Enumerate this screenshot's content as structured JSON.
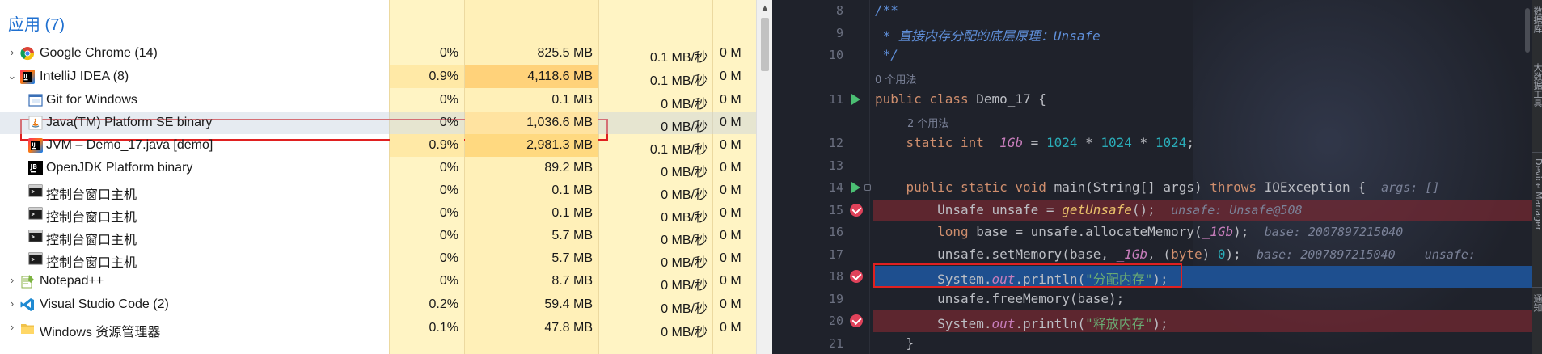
{
  "task_manager": {
    "group_header": "应用 (7)",
    "columns": [],
    "rows": [
      {
        "name": "Google Chrome (14)",
        "icon": "chrome-icon",
        "level": 0,
        "expanded": false,
        "cpu": "0%",
        "memory": "825.5 MB",
        "disk": "0.1 MB/秒",
        "network": "0 M"
      },
      {
        "name": "IntelliJ IDEA (8)",
        "icon": "intellij-icon",
        "level": 0,
        "expanded": true,
        "cpu": "0.9%",
        "memory": "4,118.6 MB",
        "disk": "0.1 MB/秒",
        "network": "0 M"
      },
      {
        "name": "Git for Windows",
        "icon": "git-window-icon",
        "level": 1,
        "cpu": "0%",
        "memory": "0.1 MB",
        "disk": "0 MB/秒",
        "network": "0 M"
      },
      {
        "name": "Java(TM) Platform SE binary",
        "icon": "java-icon",
        "level": 1,
        "selected": true,
        "cpu": "0%",
        "memory": "1,036.6 MB",
        "disk": "0 MB/秒",
        "network": "0 M"
      },
      {
        "name": "JVM – Demo_17.java [demo]",
        "icon": "intellij-icon",
        "level": 1,
        "cpu": "0.9%",
        "memory": "2,981.3 MB",
        "disk": "0.1 MB/秒",
        "network": "0 M"
      },
      {
        "name": "OpenJDK Platform binary",
        "icon": "jb-icon",
        "level": 1,
        "cpu": "0%",
        "memory": "89.2 MB",
        "disk": "0 MB/秒",
        "network": "0 M"
      },
      {
        "name": "控制台窗口主机",
        "icon": "console-icon",
        "level": 1,
        "cpu": "0%",
        "memory": "0.1 MB",
        "disk": "0 MB/秒",
        "network": "0 M"
      },
      {
        "name": "控制台窗口主机",
        "icon": "console-icon",
        "level": 1,
        "cpu": "0%",
        "memory": "0.1 MB",
        "disk": "0 MB/秒",
        "network": "0 M"
      },
      {
        "name": "控制台窗口主机",
        "icon": "console-icon",
        "level": 1,
        "cpu": "0%",
        "memory": "5.7 MB",
        "disk": "0 MB/秒",
        "network": "0 M"
      },
      {
        "name": "控制台窗口主机",
        "icon": "console-icon",
        "level": 1,
        "cpu": "0%",
        "memory": "5.7 MB",
        "disk": "0 MB/秒",
        "network": "0 M"
      },
      {
        "name": "Notepad++",
        "icon": "notepadpp-icon",
        "level": 0,
        "expanded": false,
        "cpu": "0%",
        "memory": "8.7 MB",
        "disk": "0 MB/秒",
        "network": "0 M"
      },
      {
        "name": "Visual Studio Code (2)",
        "icon": "vscode-icon",
        "level": 0,
        "expanded": false,
        "cpu": "0.2%",
        "memory": "59.4 MB",
        "disk": "0 MB/秒",
        "network": "0 M"
      },
      {
        "name": "Windows 资源管理器",
        "icon": "folder-icon",
        "level": 0,
        "expanded": false,
        "cpu": "0.1%",
        "memory": "47.8 MB",
        "disk": "0 MB/秒",
        "network": "0 M"
      }
    ],
    "colors": {
      "header_blue": "#1e6fd0",
      "heat_light": "#fff4c4",
      "heat_mid": "#ffe9a6",
      "heat_strong": "#ffd27a",
      "highlight_box": "#e02020"
    }
  },
  "editor": {
    "lines": [
      {
        "n": "8",
        "tokens": [
          [
            "cmt",
            "/**"
          ]
        ]
      },
      {
        "n": "9",
        "tokens": [
          [
            "cmt",
            " * "
          ],
          [
            "cmtz",
            "直接内存分配的底层原理："
          ],
          [
            "cmt",
            "Unsafe"
          ]
        ]
      },
      {
        "n": "10",
        "tokens": [
          [
            "cmt",
            " */"
          ]
        ]
      },
      {
        "usage": "0 个用法"
      },
      {
        "n": "11",
        "run": true,
        "tokens": [
          [
            "kw",
            "public class "
          ],
          [
            "",
            "Demo_17 {"
          ]
        ]
      },
      {
        "usage": "2 个用法",
        "indent": 1
      },
      {
        "n": "12",
        "tokens": [
          [
            "",
            "    "
          ],
          [
            "kw",
            "static int "
          ],
          [
            "fld",
            "_1Gb"
          ],
          [
            "",
            " = "
          ],
          [
            "num",
            "1024"
          ],
          [
            "",
            " * "
          ],
          [
            "num",
            "1024"
          ],
          [
            "",
            " * "
          ],
          [
            "num",
            "1024"
          ],
          [
            "",
            ";"
          ]
        ]
      },
      {
        "n": "13",
        "tokens": []
      },
      {
        "n": "14",
        "run": true,
        "fold": true,
        "tokens": [
          [
            "",
            "    "
          ],
          [
            "kw",
            "public static void "
          ],
          [
            "",
            "main(String[] args) "
          ],
          [
            "kw",
            "throws "
          ],
          [
            "",
            "IOException {  "
          ],
          [
            "hint",
            "args: []"
          ]
        ]
      },
      {
        "n": "15",
        "bp": true,
        "tokens": [
          [
            "",
            "        Unsafe unsafe = "
          ],
          [
            "mth",
            "getUnsafe"
          ],
          [
            "",
            "();  "
          ],
          [
            "hint",
            "unsafe: Unsafe@508"
          ]
        ]
      },
      {
        "n": "16",
        "tokens": [
          [
            "",
            "        "
          ],
          [
            "kw",
            "long "
          ],
          [
            "",
            "base = unsafe.allocateMemory("
          ],
          [
            "fld",
            "_1Gb"
          ],
          [
            "",
            ");  "
          ],
          [
            "hint",
            "base: 2007897215040"
          ]
        ]
      },
      {
        "n": "17",
        "tokens": [
          [
            "",
            "        unsafe.setMemory(base, "
          ],
          [
            "fld",
            "_1Gb"
          ],
          [
            "",
            ", ("
          ],
          [
            "kw",
            "byte"
          ],
          [
            "",
            ") "
          ],
          [
            "num",
            "0"
          ],
          [
            "",
            ");  "
          ],
          [
            "hint",
            "base: 2007897215040    unsafe: "
          ]
        ]
      },
      {
        "n": "18",
        "bp": true,
        "current": true,
        "tokens": [
          [
            "",
            "        System."
          ],
          [
            "fld",
            "out"
          ],
          [
            "",
            ".println("
          ],
          [
            "str",
            "\"分配内存\""
          ],
          [
            "",
            ");"
          ]
        ]
      },
      {
        "n": "19",
        "tokens": [
          [
            "",
            "        unsafe.freeMemory(base);"
          ]
        ]
      },
      {
        "n": "20",
        "bp": true,
        "tokens": [
          [
            "",
            "        System."
          ],
          [
            "fld",
            "out"
          ],
          [
            "",
            ".println("
          ],
          [
            "str",
            "\"释放内存\""
          ],
          [
            "",
            ");"
          ]
        ]
      },
      {
        "n": "21",
        "tokens": [
          [
            "",
            "    }"
          ]
        ]
      }
    ],
    "tool_window_labels": [
      "数据库",
      "大数据工具",
      "Device Manager",
      "通知"
    ],
    "colors": {
      "background": "#1f222b",
      "breakpoint_line": "#6e2a35",
      "current_line": "#1e4f8f",
      "keyword": "#cf8e6d",
      "number": "#2aacb8",
      "string": "#6aab73",
      "field": "#c77dbb",
      "comment": "#5f8fd9"
    }
  }
}
